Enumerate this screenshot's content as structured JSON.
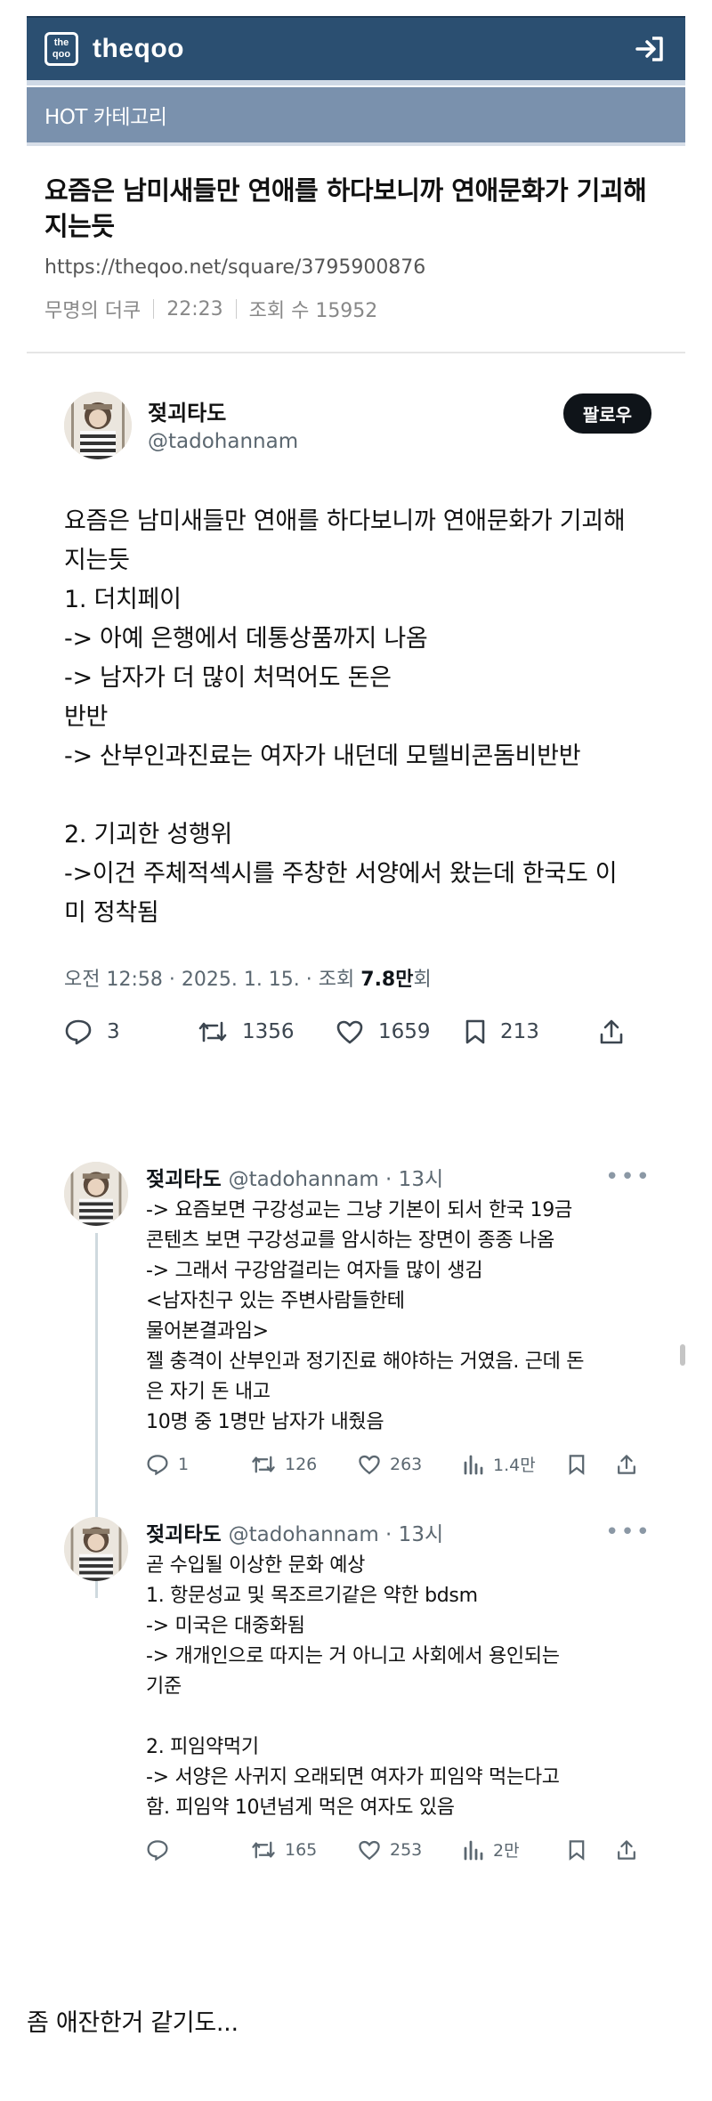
{
  "site": {
    "brand": "theqoo",
    "logo_text": "the qoo"
  },
  "category": "HOT 카테고리",
  "post": {
    "title": "요즘은 남미새들만 연애를 하다보니까 연애문화가 기괴해지는듯",
    "url": "https://theqoo.net/square/3795900876",
    "author": "무명의 더쿠",
    "time": "22:23",
    "views_label": "조회 수 15952"
  },
  "tweet": {
    "name": "젖괴타도",
    "handle": "@tadohannam",
    "follow_label": "팔로우",
    "lines": [
      "요즘은 남미새들만 연애를 하다보니까 연애문화가 기괴해",
      "지는듯",
      "1. 더치페이",
      "-> 아예 은행에서 데통상품까지 나옴",
      "-> 남자가 더 많이 처먹어도 돈은",
      "반반",
      "-> 산부인과진료는 여자가 내던데 모텔비콘돔비반반",
      "",
      "2. 기괴한 성행위",
      "->이건 주체적섹시를 주창한 서양에서 왔는데 한국도 이",
      "미 정착됨"
    ],
    "date_text": "오전 12:58 · 2025. 1. 15. · 조회 ",
    "views_bold": "7.8만",
    "views_suffix": "회",
    "replies": "3",
    "retweets": "1356",
    "likes": "1659",
    "bookmarks": "213"
  },
  "replies": [
    {
      "name": "젖괴타도",
      "handle": "@tadohannam · 13시",
      "lines": [
        "-> 요즘보면 구강성교는 그냥 기본이 되서 한국 19금",
        "콘텐츠 보면 구강성교를 암시하는 장면이 종종 나옴",
        "-> 그래서 구강암걸리는 여자들 많이 생김",
        "<남자친구 있는 주변사람들한테",
        "물어본결과임>",
        "젤 충격이 산부인과 정기진료 해야하는 거였음. 근데 돈",
        "은 자기 돈 내고",
        "10명 중 1명만 남자가 내줬음"
      ],
      "replies": "1",
      "retweets": "126",
      "likes": "263",
      "views": "1.4만"
    },
    {
      "name": "젖괴타도",
      "handle": "@tadohannam · 13시",
      "lines": [
        "곧 수입될 이상한 문화 예상",
        "1. 항문성교 및 목조르기같은 약한 bdsm",
        "-> 미국은 대중화됨",
        "-> 개개인으로 따지는 거 아니고 사회에서 용인되는",
        "기준",
        "",
        "2. 피임약먹기",
        "-> 서양은 사귀지 오래되면 여자가 피임약 먹는다고",
        "함. 피임약 10년넘게 먹은 여자도 있음"
      ],
      "replies": "",
      "retweets": "165",
      "likes": "253",
      "views": "2만"
    }
  ],
  "closing_text": "좀 애잔한거 같기도..."
}
